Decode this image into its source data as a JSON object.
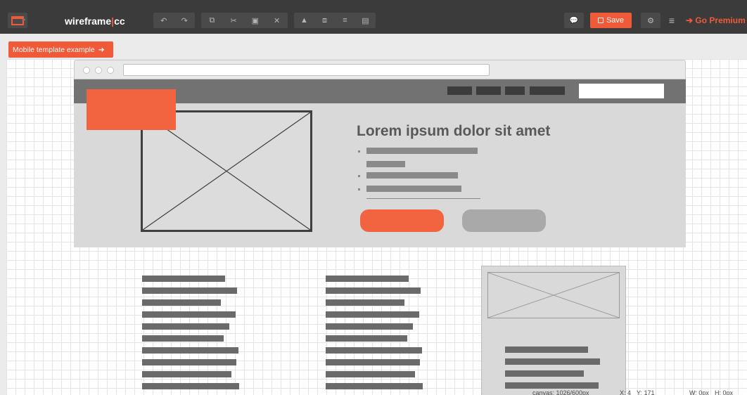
{
  "app": {
    "brand_main": "wireframe",
    "brand_sep": "|",
    "brand_suffix": "cc",
    "accent_color": "#f05a38",
    "toolbar_bg": "#3b3b3b"
  },
  "toolbar": {
    "history_group": [
      {
        "name": "undo-icon",
        "glyph": "↶"
      },
      {
        "name": "redo-icon",
        "glyph": "↷"
      }
    ],
    "edit_group": [
      {
        "name": "copy-icon",
        "glyph": "⧉"
      },
      {
        "name": "cut-icon",
        "glyph": "✂"
      },
      {
        "name": "paste-icon",
        "glyph": "▣"
      },
      {
        "name": "delete-icon",
        "glyph": "✕"
      }
    ],
    "arrange_group": [
      {
        "name": "lock-icon",
        "glyph": "▲"
      },
      {
        "name": "duplicate-icon",
        "glyph": "⧈"
      },
      {
        "name": "align-icon",
        "glyph": "≡"
      },
      {
        "name": "group-icon",
        "glyph": "▤"
      }
    ],
    "comment_icon": "💬",
    "save_label": "Save",
    "settings_icon": "⚙",
    "menu_icon": "≡",
    "premium_label": "Go Premium",
    "premium_arrow": "➔"
  },
  "template_button": {
    "label": "Mobile template example",
    "arrow": "➔"
  },
  "canvas": {
    "hero_title": "Lorem ipsum dolor sit amet"
  },
  "status": {
    "canvas_label": "canvas: 1026/600px",
    "x_label": "X: 4",
    "y_label": "Y: 171",
    "w_label": "W: 0px",
    "h_label": "H: 0px"
  }
}
